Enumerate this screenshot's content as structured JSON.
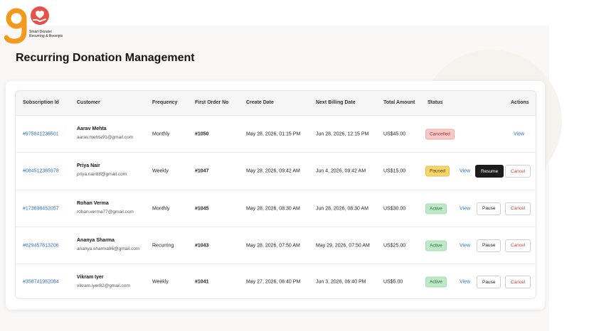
{
  "brand": {
    "tagline": "Smart Donate: Recurring & Receipts",
    "colors": {
      "orange": "#f39a1e",
      "red": "#e8504a"
    }
  },
  "page": {
    "title": "Recurring Donation Management"
  },
  "table": {
    "headers": {
      "subscription_id": "Subscription Id",
      "customer": "Customer",
      "frequency": "Frequency",
      "first_order": "First Order No",
      "create_date": "Create Date",
      "next_billing": "Next Billing Date",
      "total": "Total Amount",
      "status": "Status",
      "actions": "Actions"
    },
    "rows": [
      {
        "id": "#975841236501",
        "name": "Aarav Mehta",
        "email": "aarav.mehta91@gmail.com",
        "frequency": "Monthly",
        "order": "#1050",
        "created": "May 28, 2026, 01:15 PM",
        "next": "Jun 28, 2026, 12:15 PM",
        "total": "US$45.00",
        "status": "Cancelled",
        "actions": {
          "view": "View"
        }
      },
      {
        "id": "#084512365978",
        "name": "Priya Nair",
        "email": "priya.nair88@gmail.com",
        "frequency": "Weekly",
        "order": "#1047",
        "created": "May 28, 2026, 09:42 AM",
        "next": "Jun 4, 2026, 09:42 AM",
        "total": "US$15.00",
        "status": "Paused",
        "actions": {
          "view": "View",
          "toggle": "Resume",
          "cancel": "Cancel"
        }
      },
      {
        "id": "#173698452057",
        "name": "Rohan Verma",
        "email": "rohan.verma77@gmail.com",
        "frequency": "Monthly",
        "order": "#1045",
        "created": "May 28, 2026, 08:30 AM",
        "next": "Jun 28, 2026, 08:30 AM",
        "total": "US$30.00",
        "status": "Active",
        "actions": {
          "view": "View",
          "toggle": "Pause",
          "cancel": "Cancel"
        }
      },
      {
        "id": "#629457813206",
        "name": "Ananya Sharma",
        "email": "ananya.sharma96@gmail.com",
        "frequency": "Recurring",
        "order": "#1043",
        "created": "May 28, 2026, 07:50 AM",
        "next": "May 29, 2026, 07:50 AM",
        "total": "US$25.00",
        "status": "Active",
        "actions": {
          "view": "View",
          "toggle": "Pause",
          "cancel": "Cancel"
        }
      },
      {
        "id": "#358741962084",
        "name": "Vikram Iyer",
        "email": "vikram.iyer82@gmail.com",
        "frequency": "Weekly",
        "order": "#1041",
        "created": "May 27, 2026, 06:40 PM",
        "next": "Jun 3, 2026, 06:40 PM",
        "total": "US$5.00",
        "status": "Active",
        "actions": {
          "view": "View",
          "toggle": "Pause",
          "cancel": "Cancel"
        }
      }
    ]
  }
}
